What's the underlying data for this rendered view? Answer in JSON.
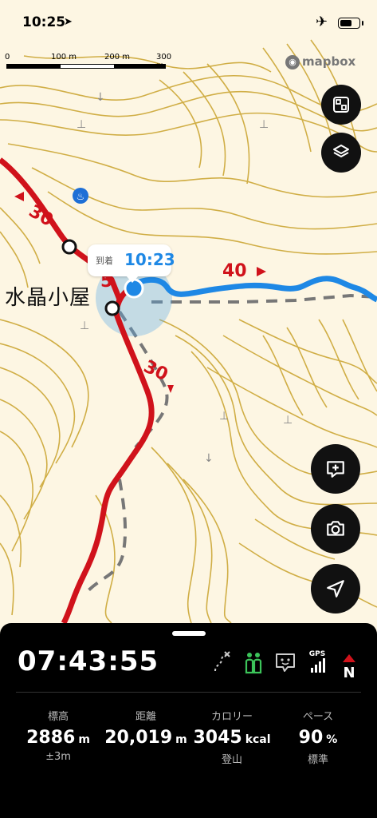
{
  "status_bar": {
    "time": "10:25",
    "location_icon": "location-arrow-icon",
    "airplane_icon": "airplane-icon"
  },
  "scale": {
    "l0": "0",
    "l1": "100 m",
    "l2": "200 m",
    "l3": "300 m"
  },
  "attribution": {
    "label": "mapbox"
  },
  "map_labels": {
    "hut_name": "水晶小屋",
    "distance_30_top": "30",
    "distance_5": "5",
    "distance_40": "40",
    "distance_30_bottom": "30"
  },
  "arrival_callout": {
    "label": "到着",
    "time": "10:23"
  },
  "map_buttons": [
    {
      "name": "layers-fit-button",
      "icon": "fit-bounds-icon"
    },
    {
      "name": "layers-button",
      "icon": "layers-icon"
    },
    {
      "name": "add-note-button",
      "icon": "add-comment-icon"
    },
    {
      "name": "camera-button",
      "icon": "camera-icon"
    },
    {
      "name": "locate-button",
      "icon": "navigation-arrow-icon"
    }
  ],
  "panel": {
    "elapsed": "07:43:55",
    "status_icons": [
      "route-off-icon",
      "companions-icon",
      "message-icon",
      "gps-signal-icon",
      "compass-north-icon"
    ],
    "gps_label": "GPS",
    "north_label": "N",
    "stats": [
      {
        "header": "標高",
        "value": "2886",
        "unit": "m",
        "sub": "±3m"
      },
      {
        "header": "距離",
        "value": "20,019",
        "unit": "m",
        "sub": ""
      },
      {
        "header": "カロリー",
        "value": "3045",
        "unit": "kcal",
        "sub": "登山"
      },
      {
        "header": "ペース",
        "value": "90",
        "unit": "%",
        "sub": "標準"
      }
    ]
  },
  "colors": {
    "route_red": "#d0121b",
    "route_blue": "#1e88e5",
    "contour": "#c9a22b",
    "panel_bg": "#000000",
    "map_bg": "#fdf6e3"
  }
}
